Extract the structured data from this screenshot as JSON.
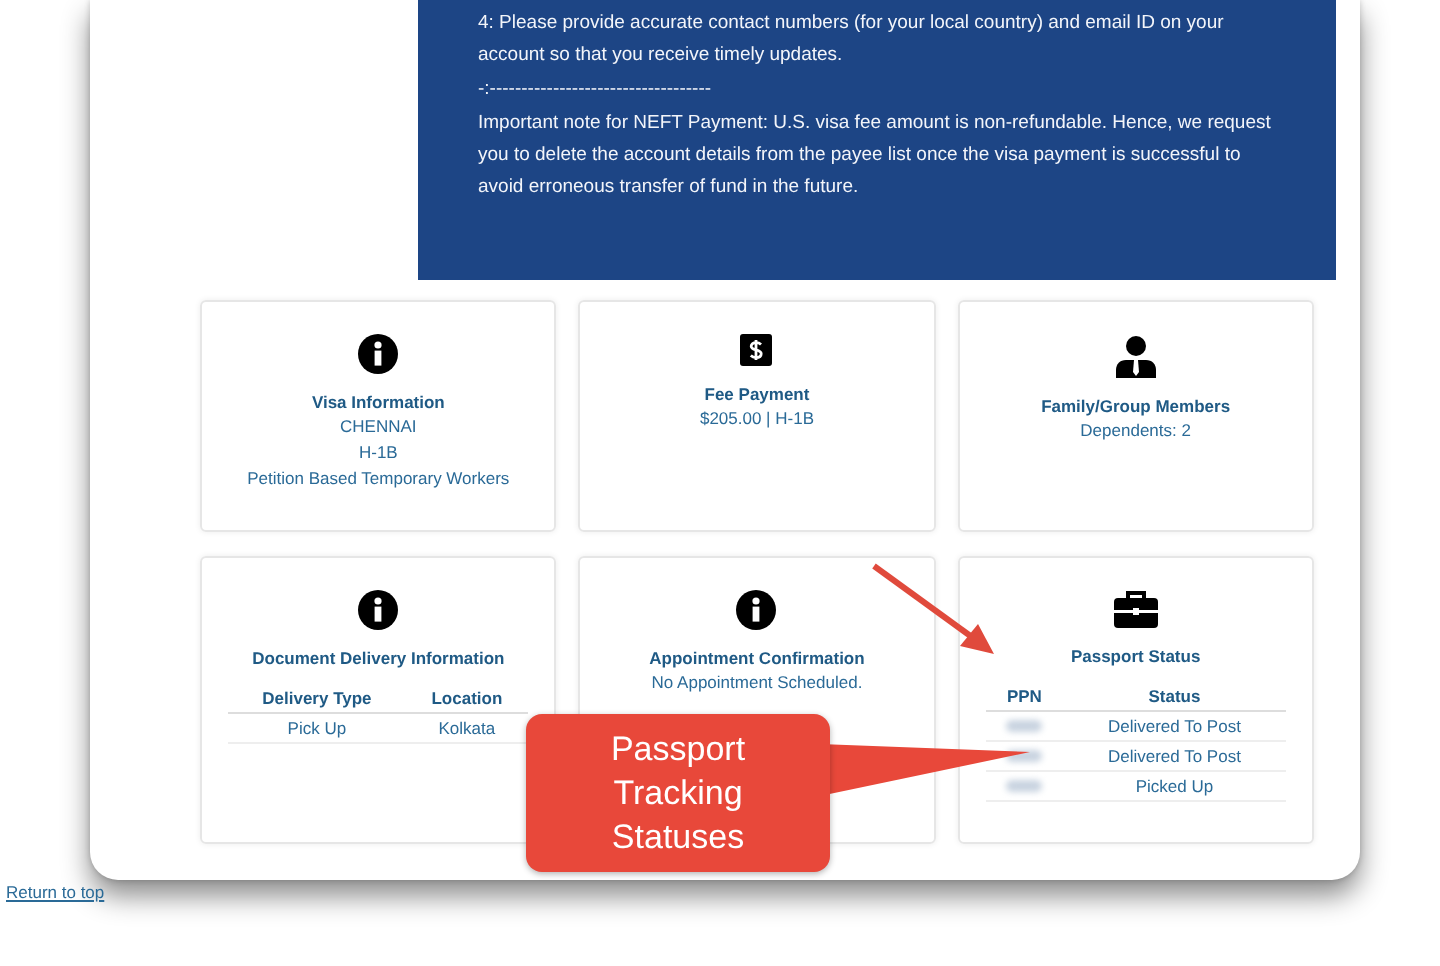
{
  "notice": {
    "paragraphs": [
      "4: Please provide accurate contact numbers (for your local country) and email ID on your account so that you receive timely updates.",
      "-:-----------------------------------",
      "Important note for NEFT Payment: U.S. visa fee amount is non-refundable. Hence, we request you to delete the account details from the payee list once the visa payment is successful to avoid erroneous transfer of fund in the future."
    ]
  },
  "cards": [
    {
      "kind": "info",
      "title": "Visa Information",
      "lines": [
        "CHENNAI",
        "H-1B",
        "Petition Based Temporary Workers"
      ]
    },
    {
      "kind": "dollar",
      "title": "Fee Payment",
      "lines": [
        "$205.00 | H-1B"
      ]
    },
    {
      "kind": "person",
      "title": "Family/Group Members",
      "lines": [
        "Dependents: 2"
      ]
    },
    {
      "kind": "info",
      "title": "Document Delivery Information",
      "table": {
        "columns": [
          "Delivery Type",
          "Location"
        ],
        "rows": [
          [
            "Pick Up",
            "Kolkata"
          ]
        ]
      }
    },
    {
      "kind": "info",
      "title": "Appointment Confirmation",
      "lines": [
        "No Appointment Scheduled."
      ]
    },
    {
      "kind": "briefcase",
      "title": "Passport Status",
      "table": {
        "columns": [
          "PPN",
          "Status"
        ],
        "rows": [
          [
            {
              "redacted": true
            },
            "Delivered To Post"
          ],
          [
            {
              "redacted": true
            },
            "Delivered To Post"
          ],
          [
            {
              "redacted": true
            },
            "Picked Up"
          ]
        ]
      }
    }
  ],
  "callout": {
    "text": "Passport Tracking Statuses"
  },
  "footer_link": "Return to top"
}
